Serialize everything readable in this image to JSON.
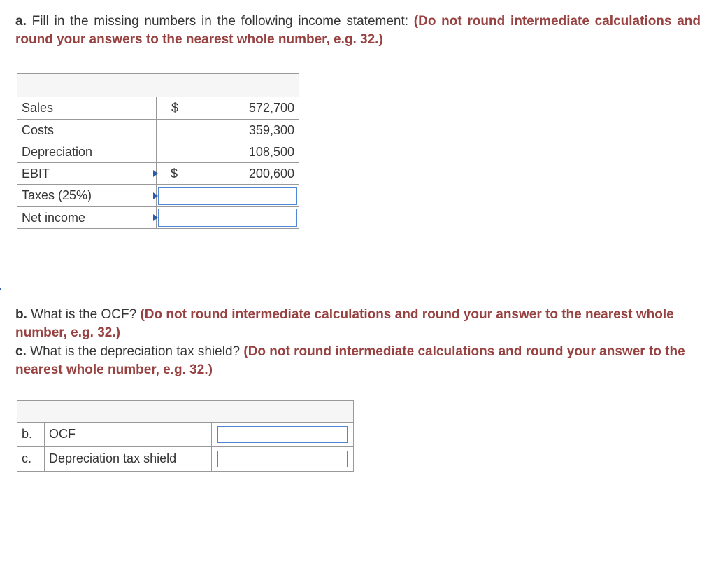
{
  "qA": {
    "prefix": "a.",
    "text": "Fill in the missing numbers in the following income statement: ",
    "instruction": "(Do not round intermediate calculations and round your answers to the nearest whole number, e.g. 32.)",
    "table": {
      "rows": [
        {
          "label": "Sales",
          "cur": "$",
          "val": "572,700",
          "input": false
        },
        {
          "label": "Costs",
          "cur": "",
          "val": "359,300",
          "input": false
        },
        {
          "label": "Depreciation",
          "cur": "",
          "val": "108,500",
          "input": false
        },
        {
          "label": "EBIT",
          "cur": "$",
          "val": "200,600",
          "input": false,
          "m": true
        },
        {
          "label": "Taxes (25%)",
          "cur": "",
          "val": "",
          "input": true
        },
        {
          "label": "Net income",
          "cur": "",
          "val": "",
          "input": true
        }
      ]
    }
  },
  "qB": {
    "prefix": "b.",
    "text": "What is the OCF? ",
    "instruction": "(Do not round intermediate calculations and round your answer to the nearest whole number, e.g. 32.)"
  },
  "qC": {
    "prefix": "c.",
    "text": "What is the depreciation tax shield? ",
    "instruction": "(Do not round intermediate calculations and round your answer to the nearest whole number, e.g. 32.)"
  },
  "table2": {
    "rows": [
      {
        "letter": "b.",
        "label": "OCF"
      },
      {
        "letter": "c.",
        "label": "Depreciation tax shield"
      }
    ]
  }
}
